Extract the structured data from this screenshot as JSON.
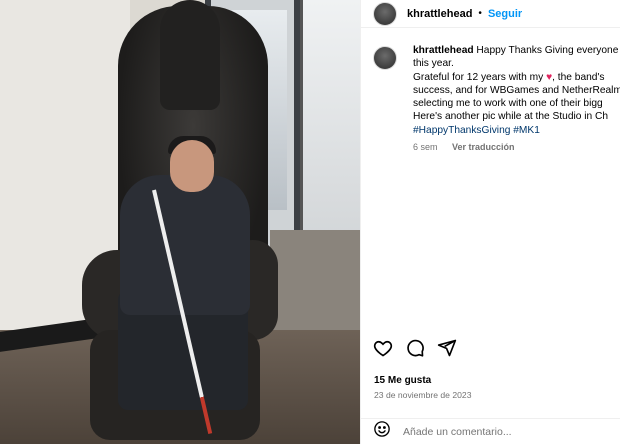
{
  "header": {
    "username": "khrattlehead",
    "separator": "•",
    "follow_label": "Seguir"
  },
  "caption": {
    "username": "khrattlehead",
    "lines": [
      "Happy Thanks Giving everyone",
      "this year.",
      "Grateful for 12 years with my",
      ", the band's",
      "success, and for WBGames and NetherRealm",
      "selecting me to work with one of their bigg",
      "Here's another pic while at the Studio in Ch"
    ],
    "heart_symbol": "♥",
    "hashtags": [
      "#HappyThanksGiving",
      "#MK1"
    ],
    "time_ago": "6 sem",
    "translate_label": "Ver traducción"
  },
  "post": {
    "likes": "15 Me gusta",
    "date": "23 de noviembre de 2023",
    "comment_placeholder": "Añade un comentario..."
  },
  "icons": [
    "heart-icon",
    "comment-icon",
    "share-icon",
    "emoji-icon"
  ],
  "colors": {
    "link_blue": "#0095f6",
    "hashtag": "#00376b",
    "heart": "#e0245e",
    "muted": "#737373"
  }
}
